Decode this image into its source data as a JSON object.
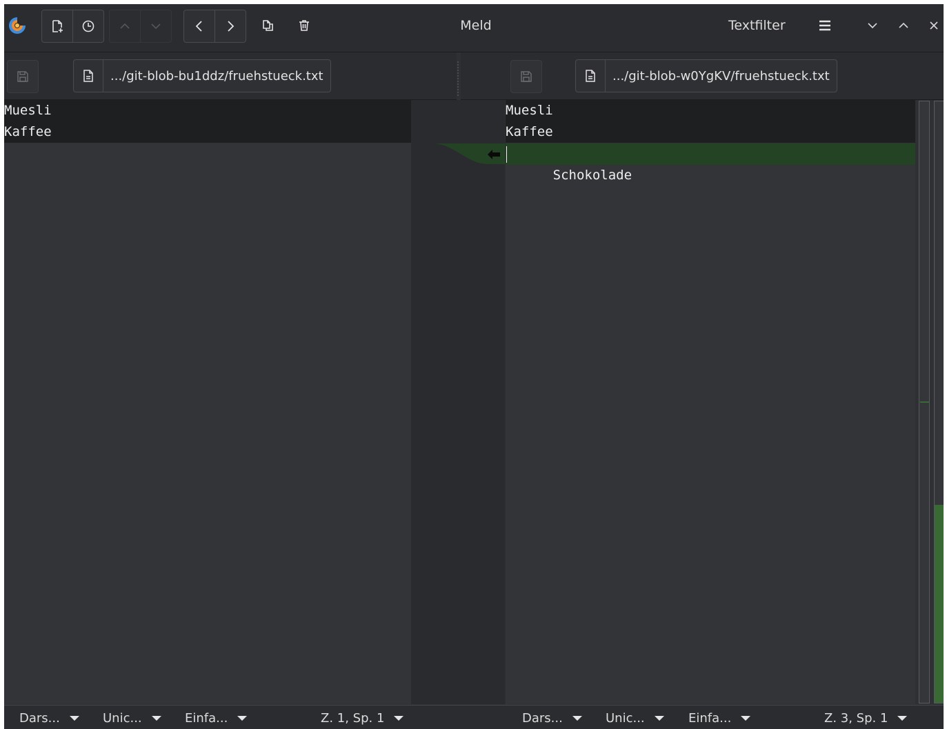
{
  "window": {
    "title": "Meld",
    "textfilter_label": "Textfilter"
  },
  "icons": {
    "app": "meld-logo-icon",
    "new_comparison": "new-comparison-icon",
    "recent": "clock-icon",
    "prev_change": "chevron-up-icon",
    "next_change": "chevron-down-icon",
    "prev_conflict": "chevron-left-icon",
    "next_conflict": "chevron-right-icon",
    "copy": "copy-icon",
    "delete": "trash-icon",
    "menu": "hamburger-menu-icon",
    "minimize": "minimize-icon",
    "maximize": "maximize-icon",
    "close": "close-icon",
    "save": "save-icon",
    "file": "file-icon",
    "merge_left": "arrow-left-icon"
  },
  "left": {
    "file_path": ".../git-blob-bu1ddz/fruehstueck.txt",
    "lines": [
      "Muesli",
      "Kaffee"
    ],
    "status": {
      "syntax": "Dars...",
      "encoding": "Unic...",
      "insert_mode": "Einfa...",
      "position": "Z. 1, Sp. 1"
    }
  },
  "right": {
    "file_path": ".../git-blob-w0YgKV/fruehstueck.txt",
    "lines": [
      "Muesli",
      "Kaffee",
      "Schokolade"
    ],
    "status": {
      "syntax": "Dars...",
      "encoding": "Unic...",
      "insert_mode": "Einfa...",
      "position": "Z. 3, Sp. 1"
    }
  },
  "colors": {
    "insert_highlight": "#244224",
    "current_line": "#1d1f21",
    "overview_change": "#3a6a33"
  }
}
